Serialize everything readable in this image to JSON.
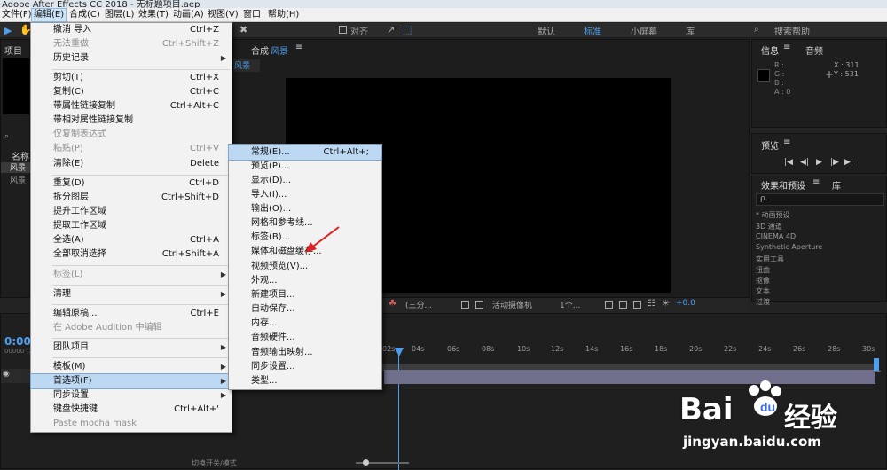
{
  "window": {
    "title": "Adobe After Effects CC 2018 - 无标题项目.aep"
  },
  "menubar": [
    "文件(F)",
    "编辑(E)",
    "合成(C)",
    "图层(L)",
    "效果(T)",
    "动画(A)",
    "视图(V)",
    "窗口",
    "帮助(H)"
  ],
  "toolbar": {
    "snap_label": "对齐",
    "workspaces": [
      "默认",
      "标准",
      "小屏幕",
      "库"
    ],
    "search_placeholder": "搜索帮助"
  },
  "project_panel": {
    "title": "项目",
    "column_name": "名称",
    "items": [
      "风景",
      "风景"
    ]
  },
  "composition_panel": {
    "title": "合成",
    "comp_name": "风景",
    "tab_name": "风景",
    "footer": {
      "resolution": "(三分...",
      "camera": "活动摄像机",
      "views": "1个...",
      "exposure": "+0.0"
    }
  },
  "info_panel": {
    "title": "信息",
    "audio_tab": "音频",
    "rgba": [
      "R :",
      "G :",
      "B :",
      "A : 0"
    ],
    "x": "X : 311",
    "y": "Y : 531"
  },
  "preview_panel": {
    "title": "预览"
  },
  "effects_panel": {
    "title": "效果和预设",
    "library_tab": "库",
    "search_placeholder": "ρ.",
    "items": [
      "* 动画预设",
      "3D 通道",
      "CINEMA 4D",
      "Synthetic Aperture",
      "实用工具",
      "扭曲",
      "抠像",
      "文本",
      "过渡"
    ]
  },
  "timeline": {
    "timecode": "0:00",
    "frame": "00000 (3",
    "ticks": [
      "02s",
      "04s",
      "06s",
      "08s",
      "10s",
      "12s",
      "14s",
      "16s",
      "18s",
      "20s",
      "22s",
      "24s",
      "26s",
      "28s",
      "30s"
    ],
    "bottom_label": "切换开关/模式"
  },
  "edit_menu": [
    {
      "label": "撤消 导入",
      "shortcut": "Ctrl+Z"
    },
    {
      "label": "无法重做",
      "shortcut": "Ctrl+Shift+Z",
      "disabled": true
    },
    {
      "label": "历史记录",
      "submenu": true
    },
    {
      "label": "剪切(T)",
      "shortcut": "Ctrl+X"
    },
    {
      "label": "复制(C)",
      "shortcut": "Ctrl+C"
    },
    {
      "label": "带属性链接复制",
      "shortcut": "Ctrl+Alt+C"
    },
    {
      "label": "带相对属性链接复制"
    },
    {
      "label": "仅复制表达式",
      "disabled": true
    },
    {
      "label": "粘贴(P)",
      "shortcut": "Ctrl+V",
      "disabled": true
    },
    {
      "label": "清除(E)",
      "shortcut": "Delete"
    },
    {
      "label": "重复(D)",
      "shortcut": "Ctrl+D"
    },
    {
      "label": "拆分图层",
      "shortcut": "Ctrl+Shift+D"
    },
    {
      "label": "提升工作区域"
    },
    {
      "label": "提取工作区域"
    },
    {
      "label": "全选(A)",
      "shortcut": "Ctrl+A"
    },
    {
      "label": "全部取消选择",
      "shortcut": "Ctrl+Shift+A"
    },
    {
      "label": "标签(L)",
      "submenu": true,
      "disabled": true
    },
    {
      "label": "清理",
      "submenu": true
    },
    {
      "label": "编辑原稿...",
      "shortcut": "Ctrl+E"
    },
    {
      "label": "在 Adobe Audition 中编辑",
      "disabled": true
    },
    {
      "label": "团队项目",
      "submenu": true
    },
    {
      "label": "模板(M)",
      "submenu": true
    },
    {
      "label": "首选项(F)",
      "submenu": true,
      "highlighted": true
    },
    {
      "label": "同步设置",
      "submenu": true
    },
    {
      "label": "键盘快捷键",
      "shortcut": "Ctrl+Alt+'"
    },
    {
      "label": "Paste mocha mask",
      "disabled": true
    }
  ],
  "prefs_menu": [
    {
      "label": "常规(E)...",
      "shortcut": "Ctrl+Alt+;",
      "highlighted": true
    },
    {
      "label": "预览(P)..."
    },
    {
      "label": "显示(D)..."
    },
    {
      "label": "导入(I)..."
    },
    {
      "label": "输出(O)..."
    },
    {
      "label": "网格和参考线..."
    },
    {
      "label": "标签(B)..."
    },
    {
      "label": "媒体和磁盘缓存..."
    },
    {
      "label": "视频预览(V)..."
    },
    {
      "label": "外观..."
    },
    {
      "label": "新建项目..."
    },
    {
      "label": "自动保存..."
    },
    {
      "label": "内存..."
    },
    {
      "label": "音频硬件..."
    },
    {
      "label": "音频输出映射..."
    },
    {
      "label": "同步设置..."
    },
    {
      "label": "类型..."
    }
  ],
  "watermark": {
    "brand": "Bai",
    "brand2": "经验",
    "url": "jingyan.baidu.com"
  }
}
